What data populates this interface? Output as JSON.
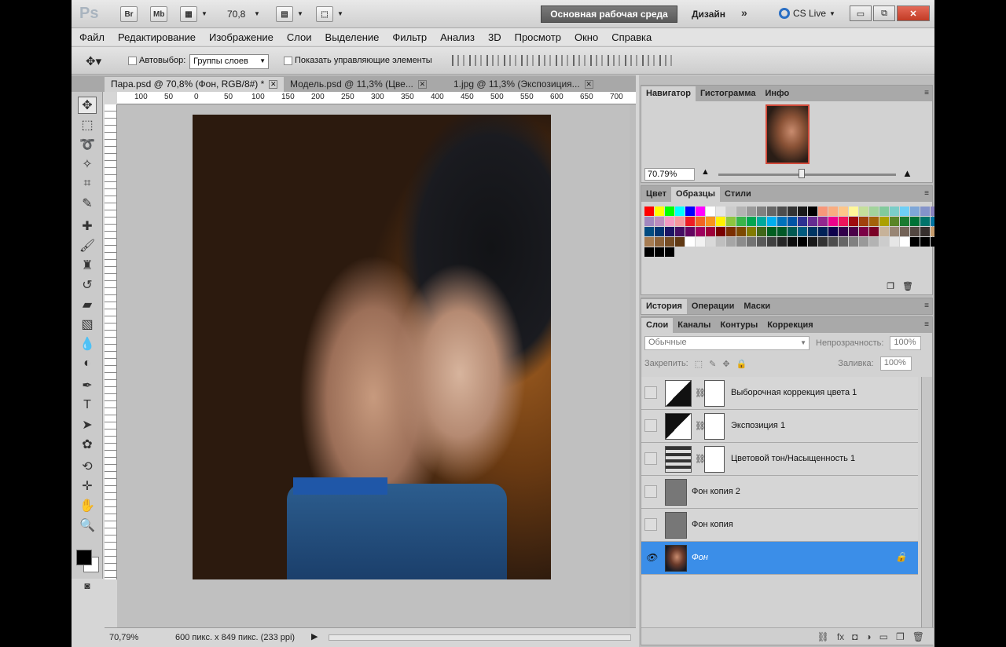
{
  "titlebar": {
    "app_logo": "Ps",
    "bridge": "Br",
    "minibridge": "Mb",
    "zoom": "70,8",
    "workspace_active": "Основная рабочая среда",
    "workspace_design": "Дизайн",
    "workspace_more": "»",
    "cslive": "CS Live",
    "win_min": "▭",
    "win_restore": "⧉",
    "win_close": "✕"
  },
  "menu": [
    "Файл",
    "Редактирование",
    "Изображение",
    "Слои",
    "Выделение",
    "Фильтр",
    "Анализ",
    "3D",
    "Просмотр",
    "Окно",
    "Справка"
  ],
  "options": {
    "autoselect_label": "Автовыбор:",
    "autoselect_value": "Группы слоев",
    "show_controls_label": "Показать управляющие элементы"
  },
  "tabs": [
    {
      "label": "Пара.psd @ 70,8% (Фон, RGB/8#) *",
      "active": true
    },
    {
      "label": "Модель.psd @ 11,3% (Цве...",
      "active": false
    },
    {
      "label": "1.jpg @ 11,3% (Экспозиция...",
      "active": false
    }
  ],
  "ruler_top": [
    "100",
    "50",
    "0",
    "50",
    "100",
    "150",
    "200",
    "250",
    "300",
    "350",
    "400",
    "450",
    "500",
    "550",
    "600",
    "650",
    "700"
  ],
  "status": {
    "zoom": "70,79%",
    "doc_info": "600 пикс. x 849 пикс. (233 ppi)"
  },
  "navigator": {
    "tabs": [
      "Навигатор",
      "Гистограмма",
      "Инфо"
    ],
    "zoom": "70.79%"
  },
  "swatches_panel": {
    "tabs": [
      "Цвет",
      "Образцы",
      "Стили"
    ],
    "colors": [
      "#ff0000",
      "#ffff00",
      "#00ff00",
      "#00ffff",
      "#0000ff",
      "#ff00ff",
      "#ffffff",
      "#e6e6e6",
      "#cccccc",
      "#b3b3b3",
      "#999999",
      "#808080",
      "#666666",
      "#4d4d4d",
      "#333333",
      "#1a1a1a",
      "#000000",
      "#f7977a",
      "#f9ad81",
      "#fdc68a",
      "#fff79a",
      "#c4df9b",
      "#a2d39c",
      "#82ca9d",
      "#7bcdc8",
      "#6ecff6",
      "#7ea7d8",
      "#8493ca",
      "#8882be",
      "#a187be",
      "#bc8dbf",
      "#f49ac2",
      "#f6989d",
      "#ed1c24",
      "#f26522",
      "#f7941d",
      "#fff200",
      "#8dc63f",
      "#39b54a",
      "#00a651",
      "#00a99d",
      "#00aeef",
      "#0072bc",
      "#0054a6",
      "#2e3192",
      "#662d91",
      "#92278f",
      "#ec008c",
      "#ed145b",
      "#9e0b0f",
      "#a0410d",
      "#a36209",
      "#aba000",
      "#598527",
      "#1a7b30",
      "#007236",
      "#00746b",
      "#0076a3",
      "#004b80",
      "#003471",
      "#1b1464",
      "#440e62",
      "#630460",
      "#9e005d",
      "#9e0039",
      "#790000",
      "#7b2e00",
      "#7d4900",
      "#827b00",
      "#406618",
      "#005e20",
      "#005826",
      "#005952",
      "#005b7f",
      "#003663",
      "#002157",
      "#0d004c",
      "#32004b",
      "#4b0049",
      "#7b0046",
      "#7a0026",
      "#c7b299",
      "#998675",
      "#736357",
      "#534741",
      "#362f2d",
      "#c69c6d",
      "#a67c52",
      "#8c6239",
      "#754c24",
      "#603913",
      "#ffffff",
      "#f2f2f2",
      "#d9d9d9",
      "#bfbfbf",
      "#a6a6a6",
      "#8c8c8c",
      "#737373",
      "#595959",
      "#404040",
      "#262626",
      "#0d0d0d",
      "#000000",
      "#1a1a1a",
      "#333333",
      "#4d4d4d",
      "#666666",
      "#808080",
      "#999999",
      "#b3b3b3",
      "#cccccc",
      "#e6e6e6",
      "#ffffff",
      "#000000",
      "#000000",
      "#000000",
      "#000000",
      "#000000",
      "#000000"
    ]
  },
  "history_panel": {
    "tabs": [
      "История",
      "Операции",
      "Маски"
    ]
  },
  "layers_panel": {
    "tabs": [
      "Слои",
      "Каналы",
      "Контуры",
      "Коррекция"
    ],
    "blend_mode": "Обычные",
    "opacity_label": "Непрозрачность:",
    "opacity_value": "100%",
    "lock_label": "Закрепить:",
    "fill_label": "Заливка:",
    "fill_value": "100%",
    "layers": [
      {
        "name": "Выборочная коррекция цвета 1",
        "type": "adjustment",
        "visible": false,
        "selected": false
      },
      {
        "name": "Экспозиция 1",
        "type": "adjustment",
        "visible": false,
        "selected": false
      },
      {
        "name": "Цветовой тон/Насыщенность 1",
        "type": "adjustment",
        "visible": false,
        "selected": false
      },
      {
        "name": "Фон копия 2",
        "type": "gray",
        "visible": false,
        "selected": false
      },
      {
        "name": "Фон копия",
        "type": "gray",
        "visible": false,
        "selected": false
      },
      {
        "name": "Фон",
        "type": "photo",
        "visible": true,
        "selected": true,
        "locked": true
      }
    ]
  },
  "colors": {
    "selected_layer": "#3b8ee8",
    "workspace_button": "#666666"
  }
}
